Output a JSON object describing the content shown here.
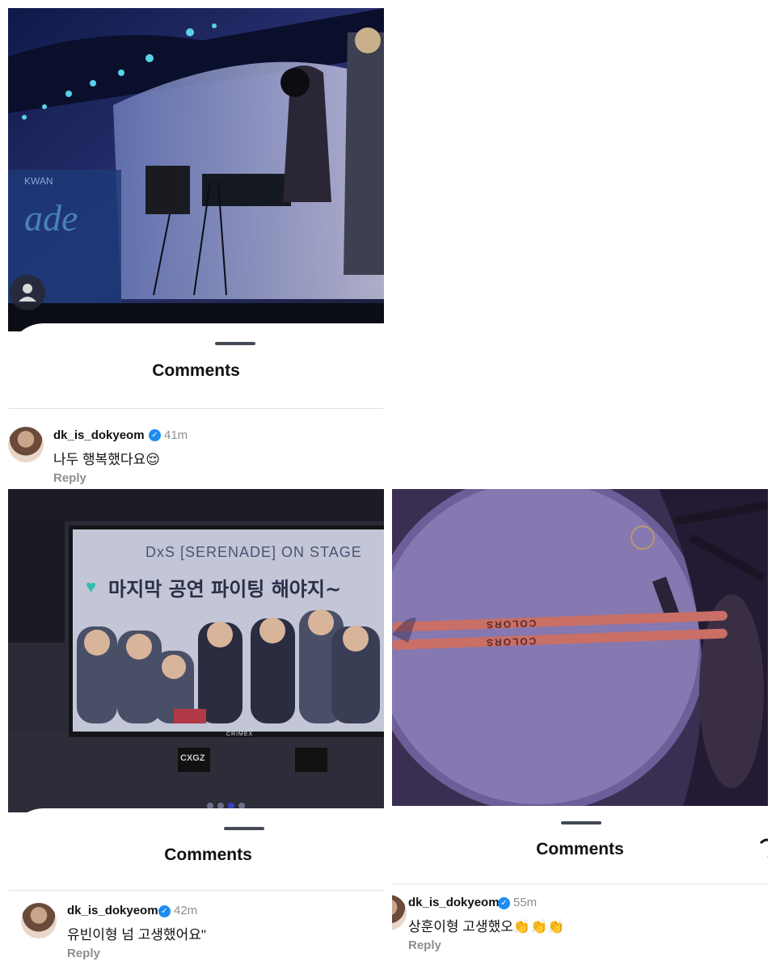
{
  "panels": [
    {
      "sheet_title": "Comments",
      "comment": {
        "username": "dk_is_dokyeom",
        "time": "41m",
        "text": "나두 행복했다요😌",
        "reply": "Reply"
      }
    },
    {
      "sheet_title": "Comments",
      "photo_screen": {
        "caption": "DxS [SERENADE] ON STAGE",
        "heart_text": "마지막 공연 파이팅 해야지~",
        "monitor_brand": "CRIMEX",
        "stand_text": "CXGZ"
      },
      "comment": {
        "username": "dk_is_dokyeom",
        "time": "42m",
        "text": "유빈이형 넘 고생했어요\"",
        "reply": "Reply"
      }
    },
    {
      "sheet_title": "Comments",
      "photo_drum": {
        "stick_brand": "COLORS"
      },
      "comment": {
        "username": "dk_is_dokyeom",
        "time": "55m",
        "text": "상훈이형 고생했오👏👏👏",
        "reply": "Reply"
      }
    }
  ],
  "colors": {
    "verified": "#1d8cf0",
    "muted_text": "#8e8e8e",
    "active_dot": "#3346c9"
  },
  "icons": [
    "person-icon",
    "verified-badge-icon",
    "share-arrow-icon"
  ]
}
